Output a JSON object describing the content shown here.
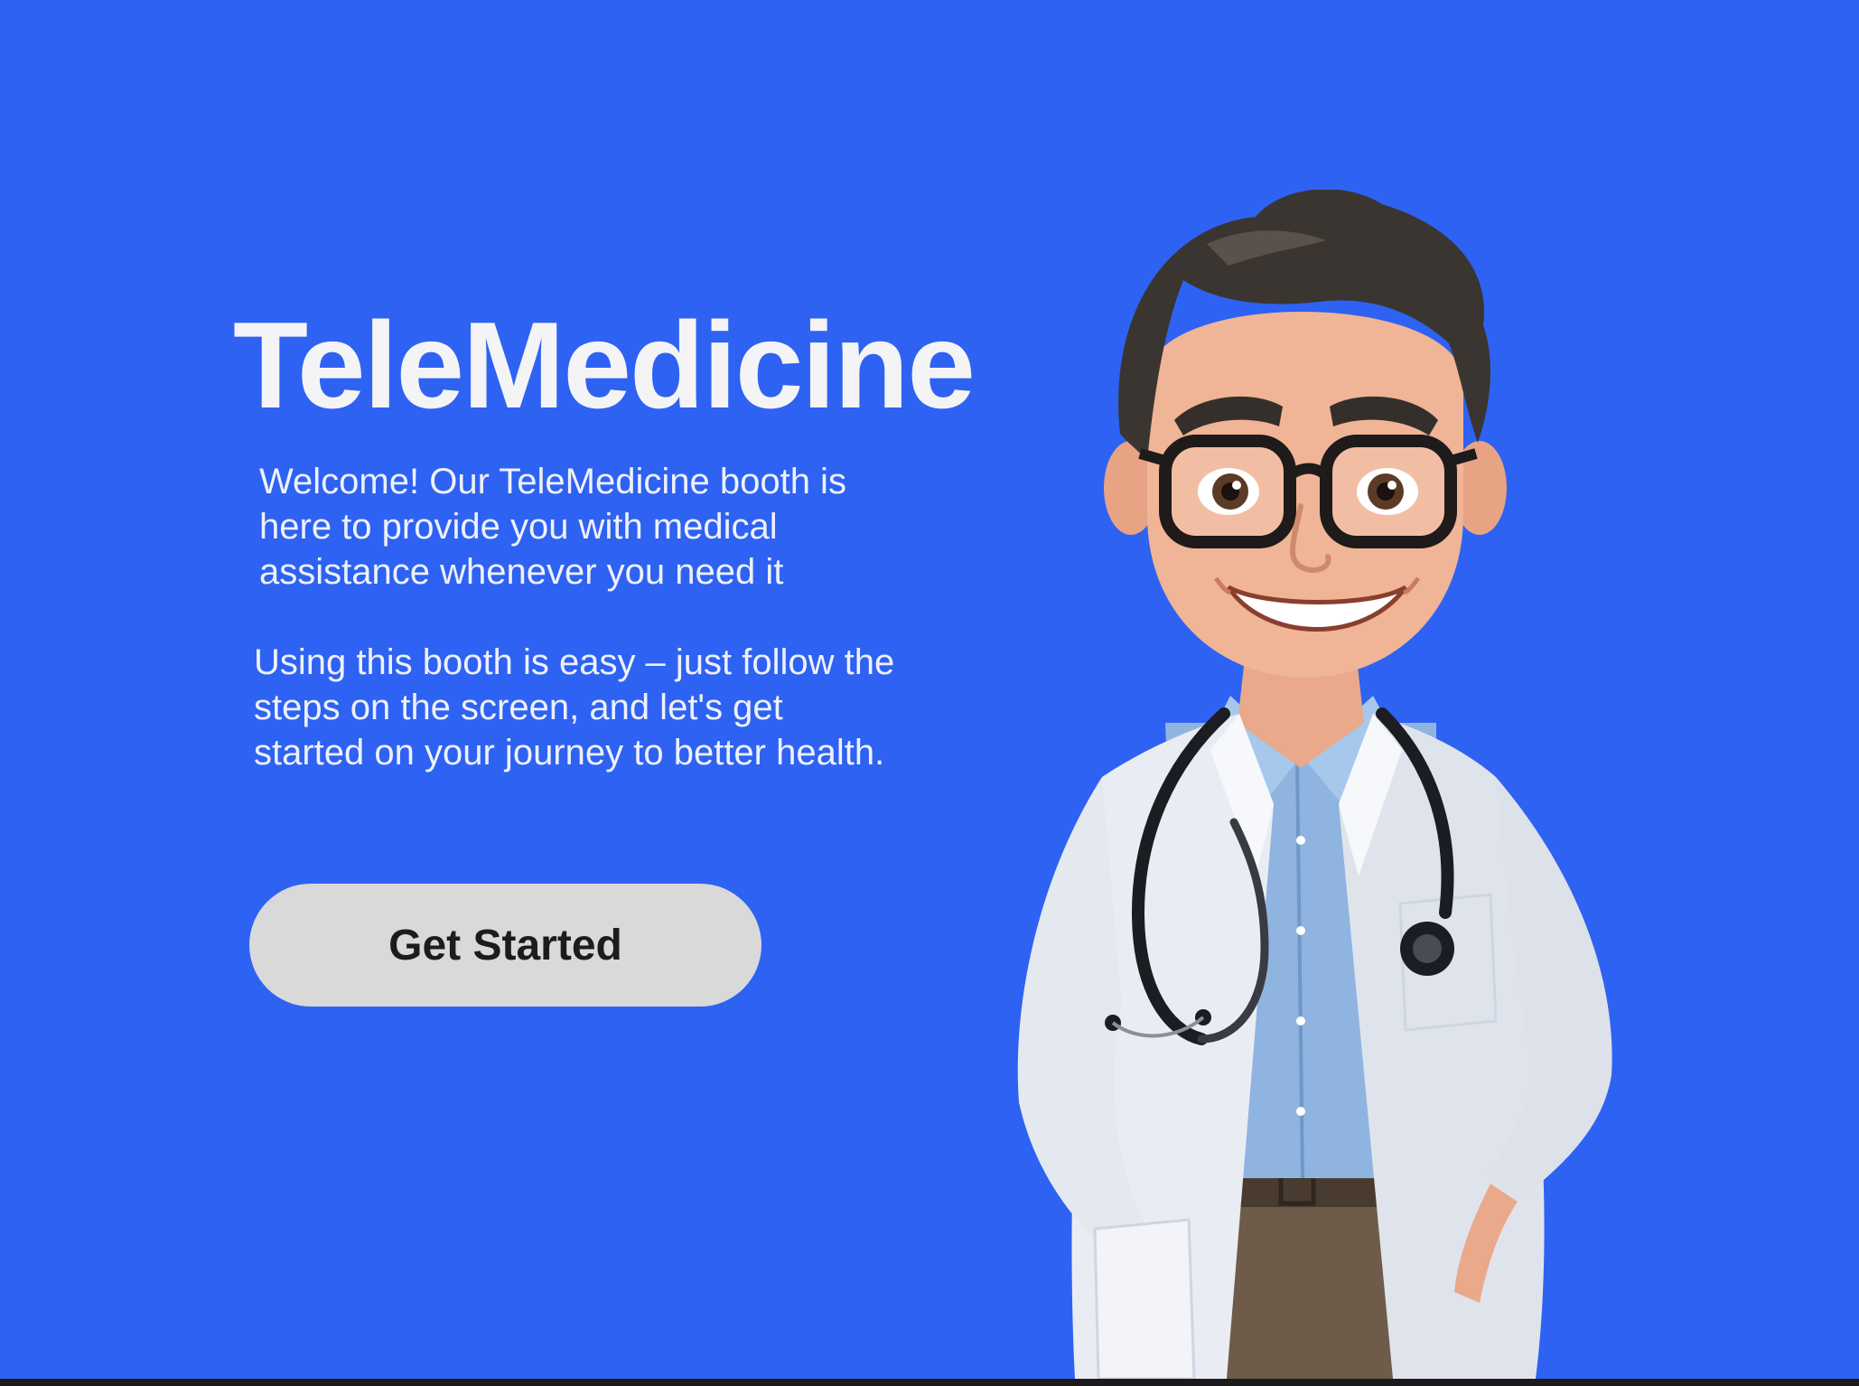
{
  "app": {
    "title": "TeleMedicine"
  },
  "content": {
    "welcome_text": "Welcome! Our TeleMedicine booth is\nhere to provide you with medical\nassistance whenever you need it",
    "instructions_text": "Using this booth is easy – just follow the\nsteps on the screen, and let's get\nstarted on your journey to better health."
  },
  "actions": {
    "get_started_label": "Get Started"
  },
  "illustration": {
    "icon": "doctor-illustration"
  },
  "colors": {
    "background": "#2e62f3",
    "button_background": "#d9d9d9",
    "button_text": "#1c1c1e",
    "title_text": "#f4f4f6"
  }
}
